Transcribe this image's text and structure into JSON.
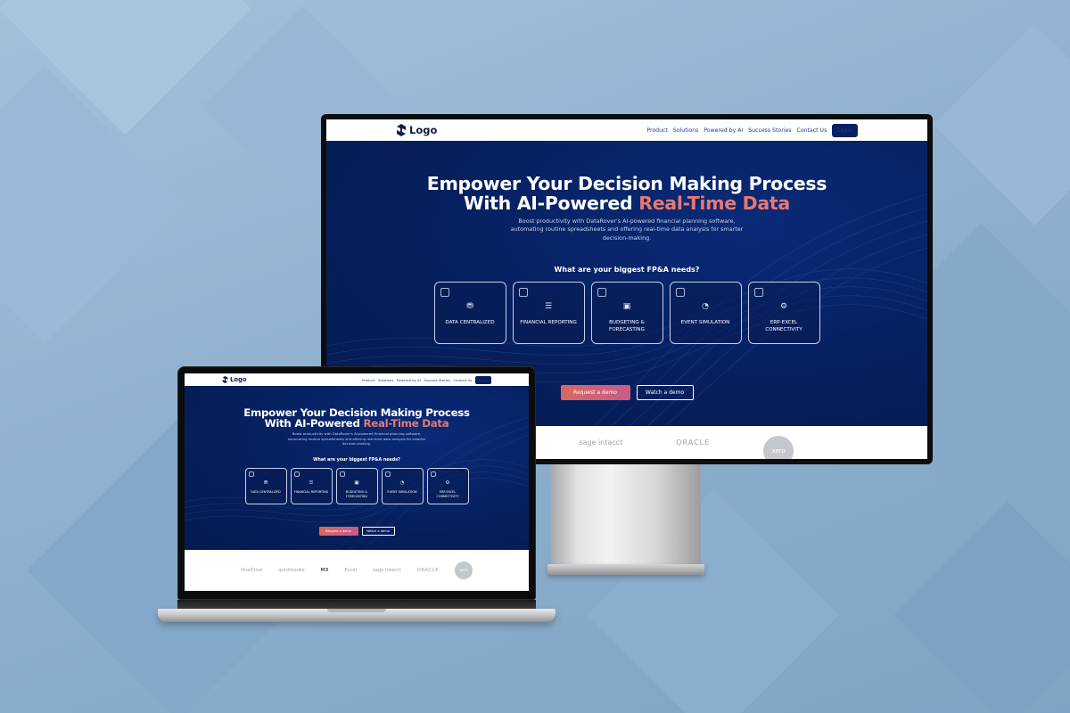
{
  "colors": {
    "background": "#8fb0cf",
    "hero_bg": "#06205e",
    "accent": "#e87870",
    "primary_button": "#d8695d",
    "login_button": "#082062"
  },
  "site": {
    "logo": {
      "icon": "logo-mark-icon",
      "text": "Logo"
    },
    "nav": {
      "items": [
        "Product",
        "Solutions",
        "Powered by AI",
        "Success Stories",
        "Contact Us"
      ],
      "login": "Login"
    },
    "hero": {
      "title_line1": "Empower Your Decision Making Process",
      "title_line2_prefix": "With AI-Powered ",
      "title_line2_accent": "Real-Time Data",
      "subtitle": "Boost productivity with DataRover's AI-powered financial planning software, automating routine spreadsheets and offering real-time data analysis for smarter decision-making.",
      "question": "What are your biggest FP&A needs?",
      "needs": [
        {
          "icon": "database-icon",
          "glyph": "⛃",
          "label": "DATA CENTRALIZED"
        },
        {
          "icon": "report-icon",
          "glyph": "☰",
          "label": "FINANCIAL REPORTING"
        },
        {
          "icon": "chart-icon",
          "glyph": "▣",
          "label": "BUDGETING & FORECASTING"
        },
        {
          "icon": "simulation-icon",
          "glyph": "◔",
          "label": "EVENT SIMULATION"
        },
        {
          "icon": "gear-icon",
          "glyph": "⚙",
          "label": "ERP-EXCEL CONNECTIVITY"
        }
      ],
      "cta_primary": "Request a demo",
      "cta_secondary": "Watch a demo"
    },
    "partners": [
      "OneDrive",
      "quickbooks",
      "M3",
      "Excel",
      "sage intacct",
      "ORACLE",
      "xero"
    ],
    "monitor_partners_visible": [
      "M3",
      "",
      "sage intacct",
      "ORACLE",
      "xero"
    ]
  }
}
